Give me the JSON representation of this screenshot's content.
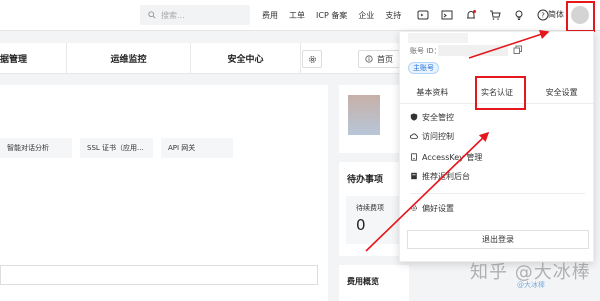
{
  "header": {
    "search_placeholder": "搜索...",
    "nav_links": [
      "费用",
      "工单",
      "ICP 备案",
      "企业",
      "支持"
    ],
    "icons": [
      "terminal-icon",
      "cloudshell-icon",
      "bell-icon",
      "cart-icon",
      "bulb-icon",
      "help-icon"
    ],
    "lang_label": "简体"
  },
  "tabs": [
    "据管理",
    "运维监控",
    "安全中心"
  ],
  "home_button_label": "首页",
  "chips": [
    "智能对话分析",
    "SSL 证书（应用...",
    "API 网关"
  ],
  "todo": {
    "title": "待办事项",
    "label": "待续费项",
    "count": "0"
  },
  "fee_title": "费用概览",
  "account_menu": {
    "account_id_label": "账号 ID：",
    "account_badge": "主账号",
    "tabs": [
      "基本资料",
      "实名认证",
      "安全设置"
    ],
    "items": [
      {
        "label": "安全管控",
        "icon": "shield-icon"
      },
      {
        "label": "访问控制",
        "icon": "cloud-icon"
      },
      {
        "label": "AccessKey 管理",
        "icon": "key-icon"
      },
      {
        "label": "推荐返利后台",
        "icon": "gift-icon"
      }
    ],
    "preferences": "偏好设置",
    "logout": "退出登录"
  },
  "watermark": {
    "text": "知乎 @大冰棒",
    "handle": "@大冰棒"
  },
  "colors": {
    "accent_red": "#e6161d",
    "badge_blue": "#1f6fd6"
  }
}
